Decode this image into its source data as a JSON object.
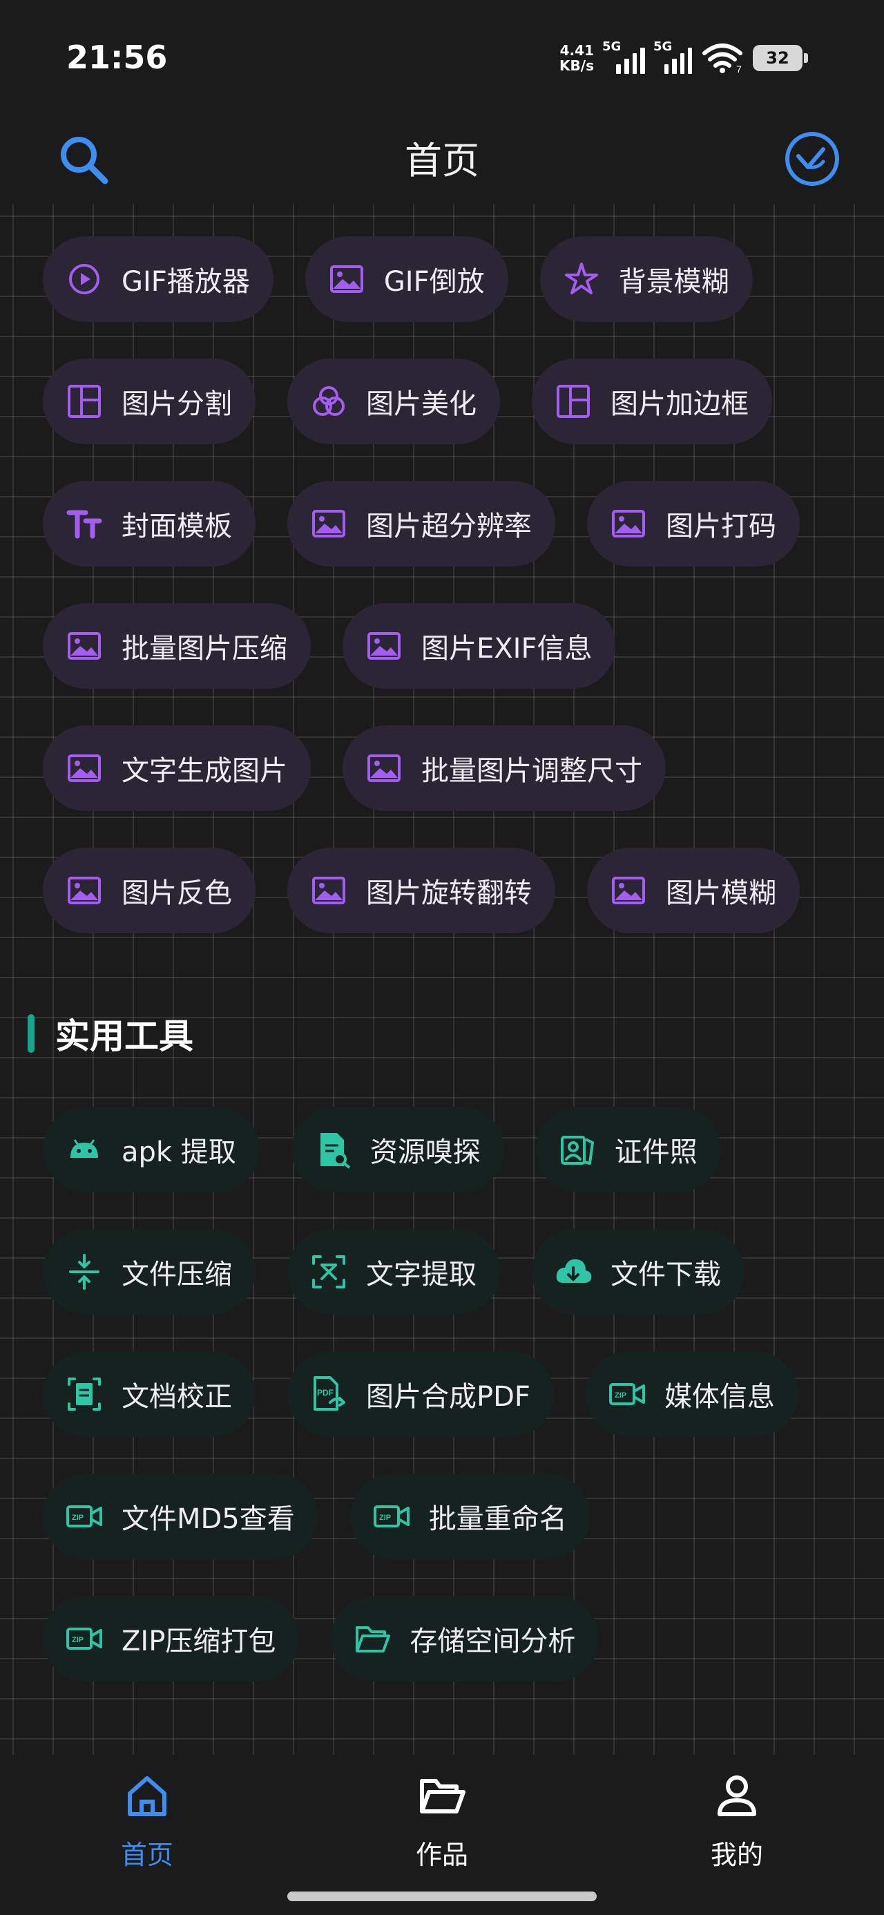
{
  "status_bar": {
    "time": "21:56",
    "net_speed_value": "4.41",
    "net_speed_unit": "KB/s",
    "sim1_label": "5G",
    "sim2_label": "5G",
    "wifi_label": "7",
    "battery": "32"
  },
  "header": {
    "title": "首页",
    "search_icon": "search-icon",
    "vip_icon": "vip-badge-icon"
  },
  "image_tools": {
    "accent": "#a35df0",
    "chip_bg": "#2c2535",
    "rows": [
      [
        {
          "label": "GIF播放器",
          "icon": "play-circle"
        },
        {
          "label": "GIF倒放",
          "icon": "image"
        },
        {
          "label": "背景模糊",
          "icon": "sparkle"
        }
      ],
      [
        {
          "label": "图片分割",
          "icon": "split"
        },
        {
          "label": "图片美化",
          "icon": "circles"
        },
        {
          "label": "图片加边框",
          "icon": "split"
        }
      ],
      [
        {
          "label": "封面模板",
          "icon": "text"
        },
        {
          "label": "图片超分辨率",
          "icon": "image"
        },
        {
          "label": "图片打码",
          "icon": "image"
        }
      ],
      [
        {
          "label": "批量图片压缩",
          "icon": "image"
        },
        {
          "label": "图片EXIF信息",
          "icon": "image"
        }
      ],
      [
        {
          "label": "文字生成图片",
          "icon": "image"
        },
        {
          "label": "批量图片调整尺寸",
          "icon": "image"
        }
      ],
      [
        {
          "label": "图片反色",
          "icon": "image"
        },
        {
          "label": "图片旋转翻转",
          "icon": "image"
        },
        {
          "label": "图片模糊",
          "icon": "image"
        }
      ]
    ]
  },
  "utility_section": {
    "title": "实用工具",
    "accent": "#2ec4a6",
    "chip_bg": "#16221f",
    "rows": [
      [
        {
          "label": "apk 提取",
          "icon": "android"
        },
        {
          "label": "资源嗅探",
          "icon": "doc-search"
        },
        {
          "label": "证件照",
          "icon": "id-photo"
        }
      ],
      [
        {
          "label": "文件压缩",
          "icon": "compress"
        },
        {
          "label": "文字提取",
          "icon": "text-scan"
        },
        {
          "label": "文件下载",
          "icon": "cloud-download"
        }
      ],
      [
        {
          "label": "文档校正",
          "icon": "doc-scan"
        },
        {
          "label": "图片合成PDF",
          "icon": "pdf"
        },
        {
          "label": "媒体信息",
          "icon": "video-zip"
        }
      ],
      [
        {
          "label": "文件MD5查看",
          "icon": "video-zip"
        },
        {
          "label": "批量重命名",
          "icon": "video-zip"
        }
      ],
      [
        {
          "label": "ZIP压缩打包",
          "icon": "video-zip"
        },
        {
          "label": "存储空间分析",
          "icon": "folder"
        }
      ]
    ]
  },
  "bottom_nav": {
    "active_color": "#3e8df0",
    "items": [
      {
        "label": "首页",
        "icon": "home-icon",
        "active": true
      },
      {
        "label": "作品",
        "icon": "folder-icon",
        "active": false
      },
      {
        "label": "我的",
        "icon": "user-icon",
        "active": false
      }
    ]
  }
}
